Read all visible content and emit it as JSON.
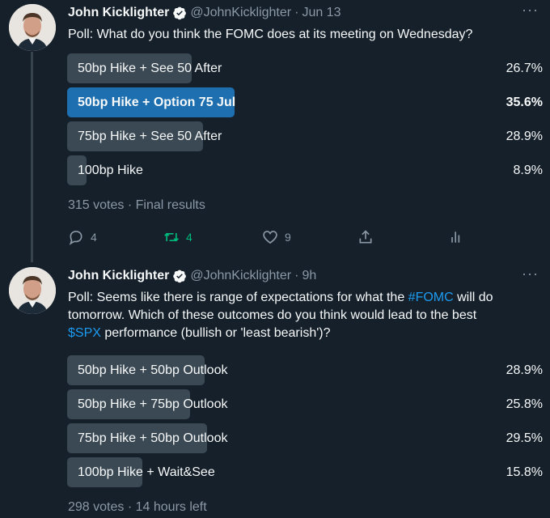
{
  "tweets": [
    {
      "name": "John Kicklighter",
      "handle": "@JohnKicklighter",
      "separator": "·",
      "time": "Jun 13",
      "more": "···",
      "text": "Poll: What do you think the FOMC does at its meeting on Wednesday?",
      "poll": {
        "options": [
          {
            "label": "50bp Hike + See 50 After",
            "percent": "26.7%"
          },
          {
            "label": "50bp Hike + Option 75 Jul",
            "percent": "35.6%"
          },
          {
            "label": "75bp Hike + See 50 After",
            "percent": "28.9%"
          },
          {
            "label": "100bp Hike",
            "percent": "8.9%"
          }
        ],
        "votes": "315 votes",
        "status": "Final results"
      },
      "actions": {
        "reply_count": "4",
        "retweet_count": "4",
        "like_count": "9"
      }
    },
    {
      "name": "John Kicklighter",
      "handle": "@JohnKicklighter",
      "separator": "·",
      "time": "9h",
      "more": "···",
      "text_line1": "Poll: Seems like there is range of expectations for what the ",
      "hashtag": "#FOMC",
      "text_line1_end": " will do",
      "text_line2": "tomorrow. Which of these outcomes do you think would lead to the best",
      "cashtag": "$SPX",
      "text_line3": " performance (bullish or 'least bearish')?",
      "poll": {
        "options": [
          {
            "label": "50bp Hike + 50bp Outlook",
            "percent": "28.9%"
          },
          {
            "label": "50bp Hike + 75bp Outlook",
            "percent": "25.8%"
          },
          {
            "label": "75bp Hike + 50bp Outlook",
            "percent": "29.5%"
          },
          {
            "label": "100bp Hike + Wait&See",
            "percent": "15.8%"
          }
        ],
        "votes": "298 votes",
        "status": "14 hours left"
      }
    }
  ],
  "colors": {
    "background": "#15202b",
    "text": "#f7f9f9",
    "muted": "#8b98a5",
    "link": "#1d9bf0",
    "poll_bar": "#3b4954",
    "poll_bar_winner": "#1d6fb0",
    "retweet": "#00ba7c"
  },
  "icons": [
    "verified-badge-icon",
    "more-icon",
    "reply-icon",
    "retweet-icon",
    "like-icon",
    "share-icon",
    "analytics-icon"
  ]
}
